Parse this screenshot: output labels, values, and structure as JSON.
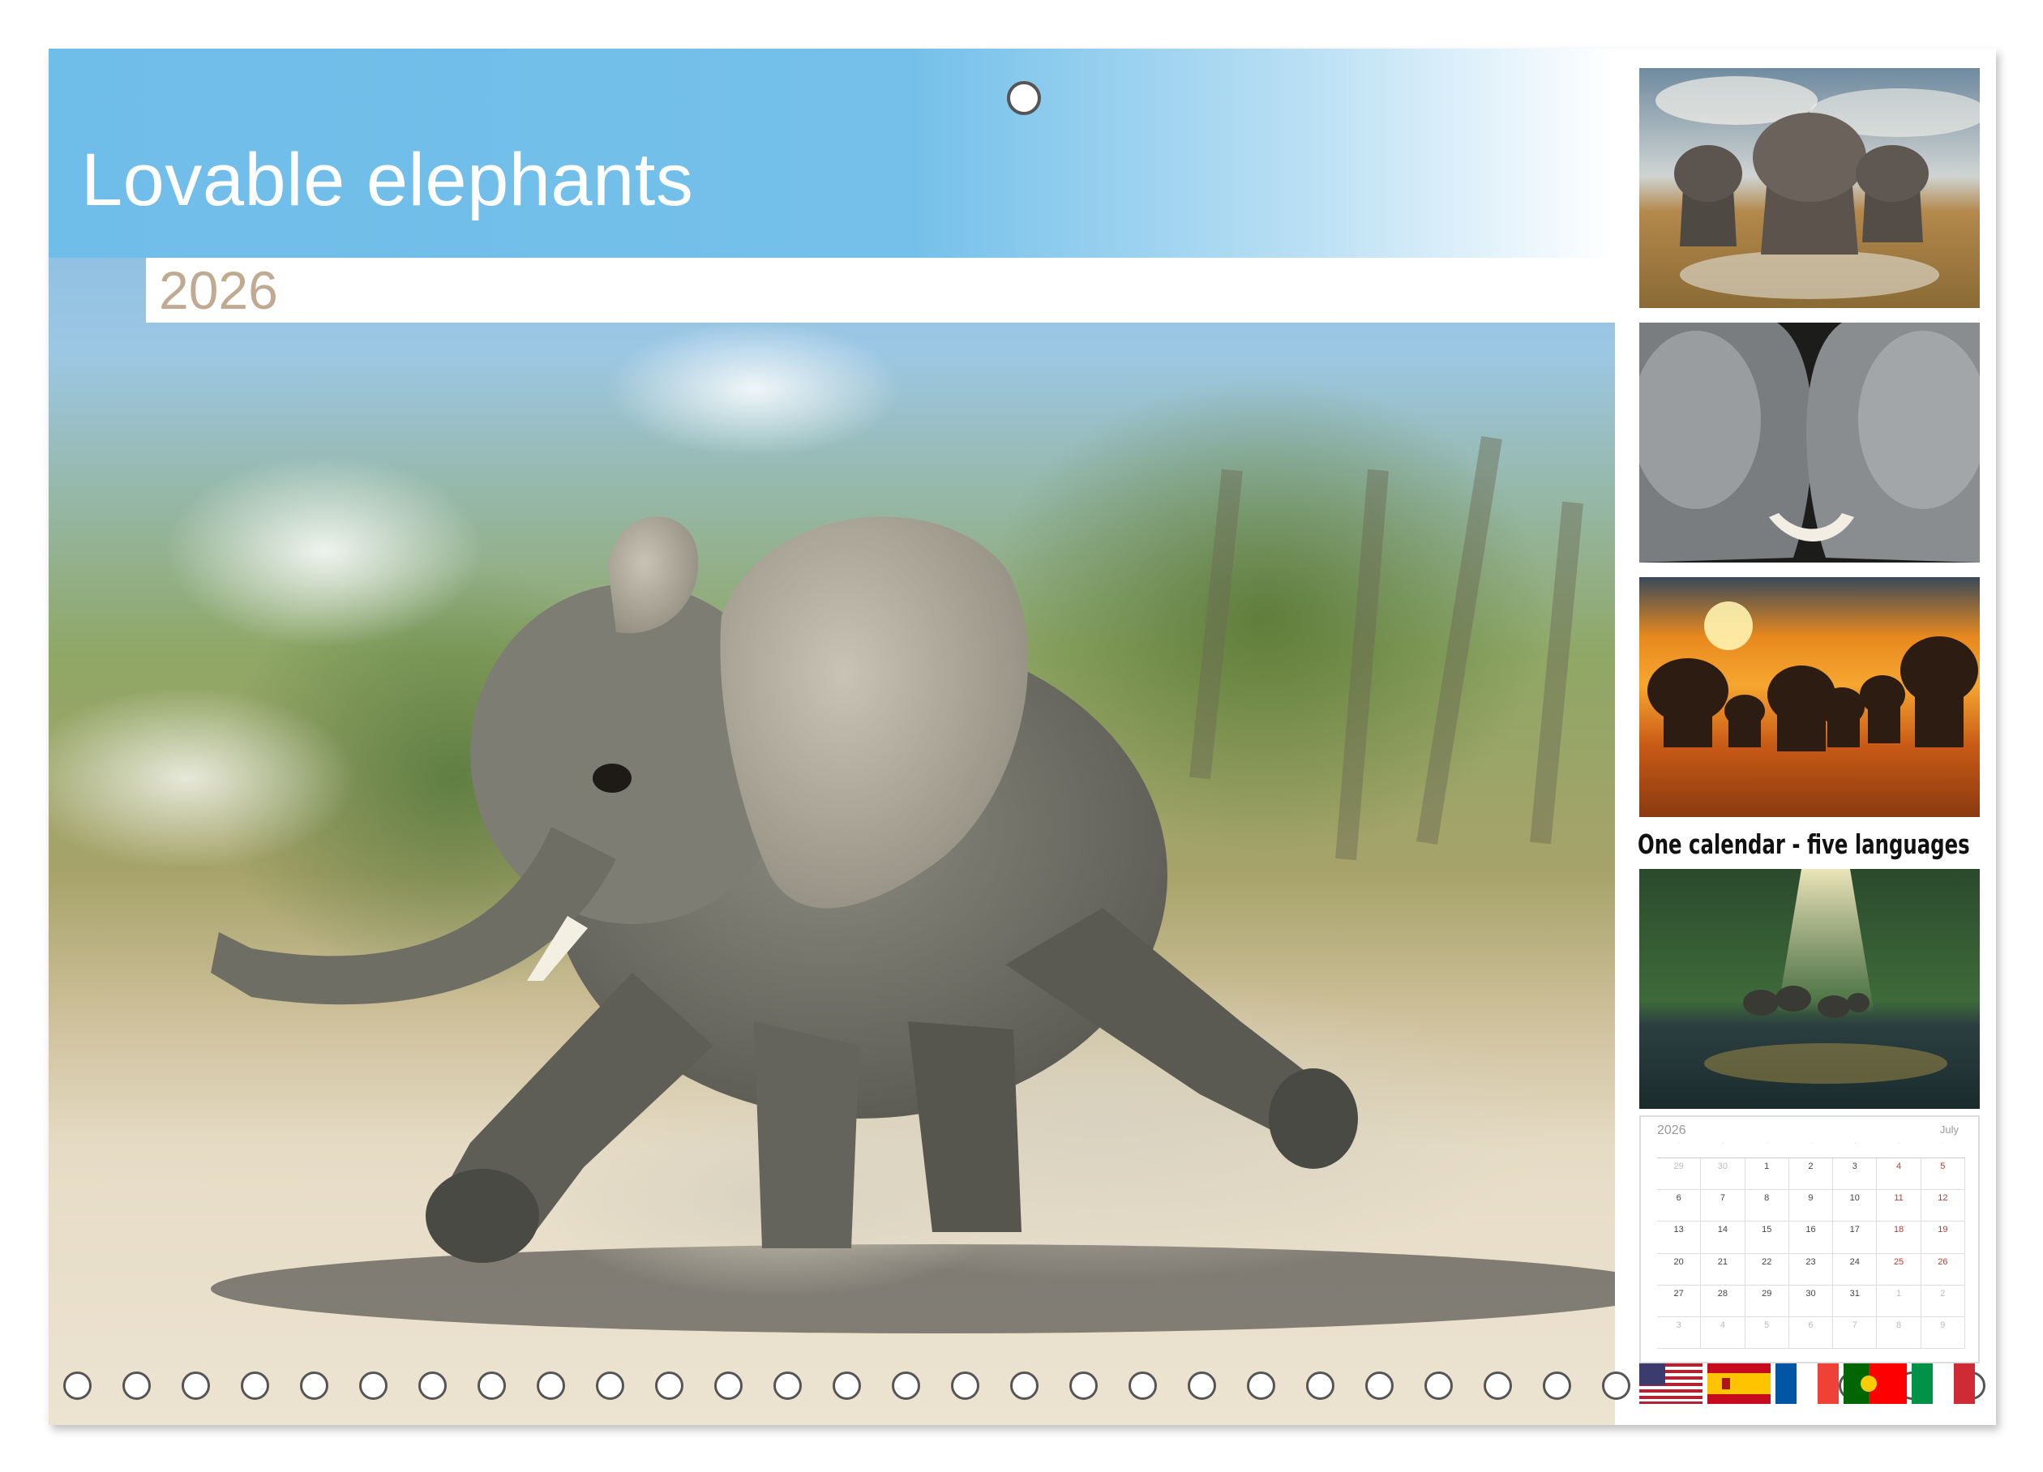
{
  "calendar": {
    "title": "Lovable elephants",
    "year": "2026",
    "tagline": "One calendar - five languages"
  },
  "preview_calendar": {
    "year": "2026",
    "month": "July",
    "rows": [
      [
        "29",
        "30",
        "1",
        "2",
        "3",
        "4",
        "5"
      ],
      [
        "6",
        "7",
        "8",
        "9",
        "10",
        "11",
        "12"
      ],
      [
        "13",
        "14",
        "15",
        "16",
        "17",
        "18",
        "19"
      ],
      [
        "20",
        "21",
        "22",
        "23",
        "24",
        "25",
        "26"
      ],
      [
        "27",
        "28",
        "29",
        "30",
        "31",
        "1",
        "2"
      ],
      [
        "3",
        "4",
        "5",
        "6",
        "7",
        "8",
        "9"
      ]
    ],
    "muted_first_row": 2,
    "muted_last_cells": 2
  },
  "thumbnails": [
    {
      "subject": "elephant-herd-charging"
    },
    {
      "subject": "two-elephants-touching-trunks"
    },
    {
      "subject": "elephant-herd-at-sunset"
    },
    {
      "subject": "elephants-in-jungle-river"
    }
  ],
  "flags": [
    "usa-flag-icon",
    "spain-flag-icon",
    "france-flag-icon",
    "portugal-flag-icon",
    "italy-flag-icon"
  ],
  "colors": {
    "banner": "#74c0ea",
    "year_text": "#c0aa92",
    "title_text": "#ffffff"
  }
}
